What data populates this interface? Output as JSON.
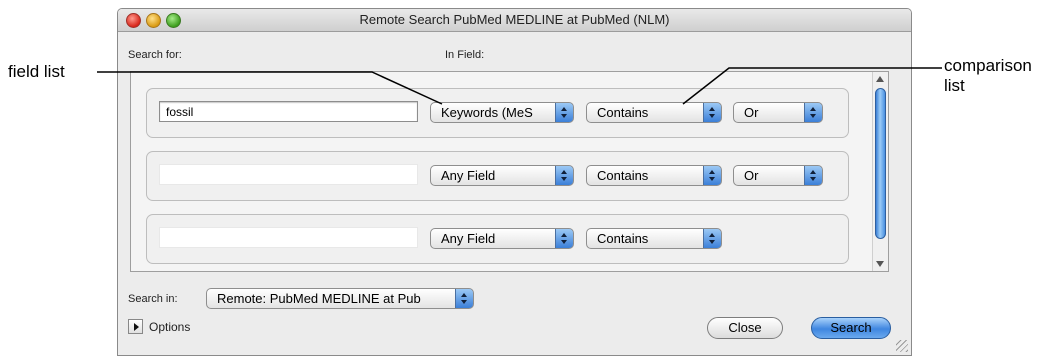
{
  "callouts": {
    "field_list": "field list",
    "comparison_list_line1": "comparison",
    "comparison_list_line2": "list"
  },
  "window": {
    "title": "Remote Search PubMed MEDLINE at PubMed (NLM)"
  },
  "labels": {
    "search_for": "Search for:",
    "in_field": "In Field:",
    "search_in": "Search in:",
    "options": "Options"
  },
  "rows": [
    {
      "term": "fossil",
      "field": "Keywords (MeS",
      "comparison": "Contains",
      "operator": "Or"
    },
    {
      "term": "",
      "field": "Any Field",
      "comparison": "Contains",
      "operator": "Or"
    },
    {
      "term": "",
      "field": "Any Field",
      "comparison": "Contains",
      "operator": ""
    }
  ],
  "search_in_value": "Remote: PubMed MEDLINE at Pub",
  "buttons": {
    "close": "Close",
    "search": "Search"
  },
  "colors": {
    "accent_blue": "#3b7fd8",
    "window_bg": "#ececec"
  }
}
